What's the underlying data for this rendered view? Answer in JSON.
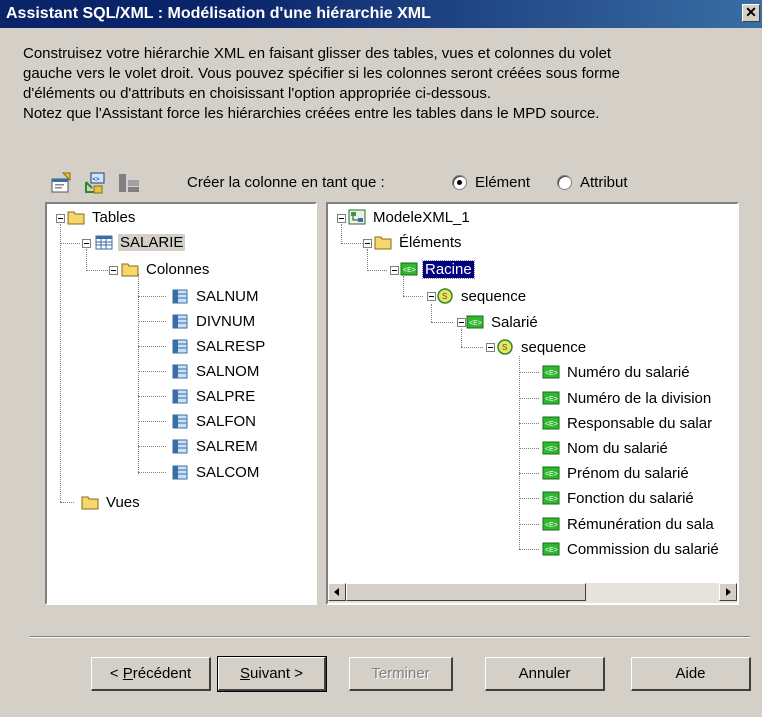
{
  "window": {
    "title": "Assistant SQL/XML : Modélisation d'une hiérarchie XML",
    "close": "✕"
  },
  "description": [
    "Construisez votre hiérarchie XML en faisant glisser des tables, vues et colonnes du volet",
    "gauche vers le volet droit. Vous pouvez spécifier si les colonnes seront créées sous forme",
    "d'éléments ou d'attributs en choisissant l'option appropriée ci-dessous.",
    "Notez que l'Assistant force les hiérarchies créées entre les tables dans le MPD source."
  ],
  "toolbar": {
    "icons": [
      "properties-icon",
      "xml-element-icon",
      "flatten-icon"
    ],
    "create_label": "Créer la colonne en tant que :",
    "option_element": "Elément",
    "option_attribute": "Attribut",
    "selected_option": "Elément"
  },
  "left_tree": {
    "tables": "Tables",
    "table": "SALARIE",
    "columns_folder": "Colonnes",
    "columns": [
      "SALNUM",
      "DIVNUM",
      "SALRESP",
      "SALNOM",
      "SALPRE",
      "SALFON",
      "SALREM",
      "SALCOM"
    ],
    "views": "Vues"
  },
  "right_tree": {
    "model": "ModeleXML_1",
    "elements_folder": "Éléments",
    "root": "Racine",
    "sequence1": "sequence",
    "salarie": "Salarié",
    "sequence2": "sequence",
    "items": [
      "Numéro du salarié",
      "Numéro de la division",
      "Responsable du salar",
      "Nom du salarié",
      "Prénom du salarié",
      "Fonction du salarié",
      "Rémunération du sala",
      "Commission du salarié"
    ]
  },
  "buttons": {
    "previous_prefix": "< ",
    "previous_key": "P",
    "previous_rest": "récédent",
    "next_key": "S",
    "next_rest": "uivant >",
    "finish": "Terminer",
    "cancel": "Annuler",
    "help": "Aide"
  }
}
